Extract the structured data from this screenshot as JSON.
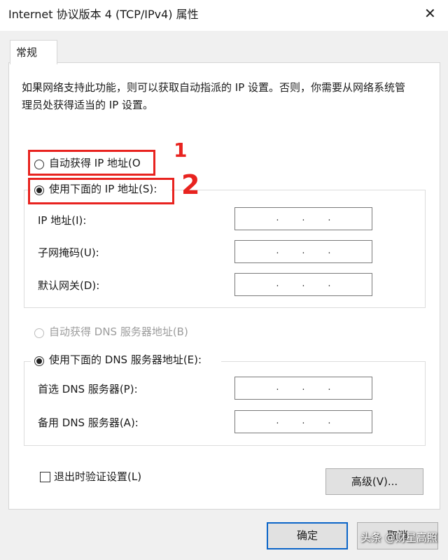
{
  "window": {
    "title": "Internet 协议版本 4 (TCP/IPv4) 属性",
    "close_glyph": "✕"
  },
  "tabs": [
    {
      "label": "常规"
    }
  ],
  "description": "如果网络支持此功能，则可以获取自动指派的 IP 设置。否则，你需要从网络系统管理员处获得适当的 IP 设置。",
  "ip_mode": {
    "auto_label": "自动获得 IP 地址(O",
    "manual_label": "使用下面的 IP 地址(S):",
    "selected": "manual"
  },
  "ip_fields": [
    {
      "label": "IP 地址(I):",
      "value": ""
    },
    {
      "label": "子网掩码(U):",
      "value": ""
    },
    {
      "label": "默认网关(D):",
      "value": ""
    }
  ],
  "dns_mode": {
    "auto_label": "自动获得 DNS 服务器地址(B)",
    "manual_label": "使用下面的 DNS 服务器地址(E):",
    "selected": "manual",
    "auto_disabled": true
  },
  "dns_fields": [
    {
      "label": "首选 DNS 服务器(P):",
      "value": ""
    },
    {
      "label": "备用 DNS 服务器(A):",
      "value": ""
    }
  ],
  "validate_on_exit": {
    "label": "退出时验证设置(L)",
    "checked": false
  },
  "buttons": {
    "advanced": "高级(V)...",
    "ok": "确定",
    "cancel": "取消"
  },
  "annotations": {
    "marker_1": "1",
    "marker_2": "2",
    "color": "#e8231f"
  },
  "watermark": "头条 @财星高照"
}
